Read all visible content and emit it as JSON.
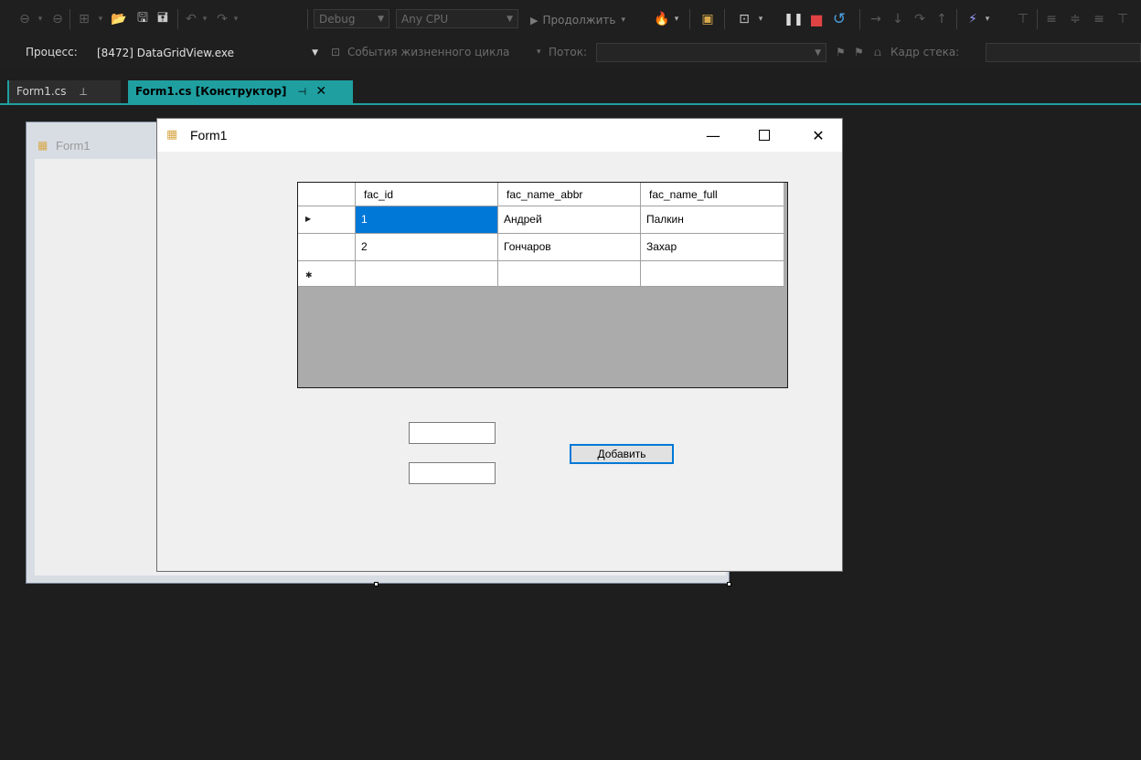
{
  "toolbar": {
    "config": "Debug",
    "platform": "Any CPU",
    "continue_label": "Продолжить"
  },
  "debug_bar": {
    "process_label": "Процесс:",
    "process_value": "[8472] DataGridView.exe",
    "lifecycle_label": "События жизненного цикла",
    "thread_label": "Поток:",
    "stack_label": "Кадр стека:"
  },
  "tabs": [
    {
      "label": "Form1.cs",
      "active": false
    },
    {
      "label": "Form1.cs [Конструктор]",
      "active": true
    }
  ],
  "designer": {
    "form_title": "Form1"
  },
  "runtime_form": {
    "title": "Form1",
    "grid": {
      "columns": [
        "fac_id",
        "fac_name_abbr",
        "fac_name_full"
      ],
      "rows": [
        [
          "1",
          "Андрей",
          "Палкин"
        ],
        [
          "2",
          "Гончаров",
          "Захар"
        ]
      ],
      "selected_row": 0,
      "selected_col": 0
    },
    "add_button": "Добавить"
  },
  "colors": {
    "accent": "#1f9fa0",
    "selection": "#0078d7"
  }
}
